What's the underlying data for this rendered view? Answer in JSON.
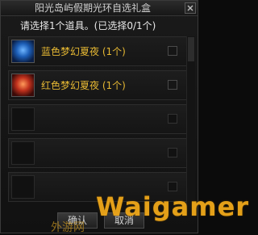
{
  "window": {
    "title": "阳光岛屿假期光环自选礼盒"
  },
  "instruction": "请选择1个道具。(已选择0/1个)",
  "items": [
    {
      "label": "蓝色梦幻夏夜 (1个)",
      "icon": "blue-summer-night-icon"
    },
    {
      "label": "红色梦幻夏夜 (1个)",
      "icon": "red-summer-night-icon"
    },
    {
      "label": "",
      "icon": "empty-slot"
    },
    {
      "label": "",
      "icon": "empty-slot"
    },
    {
      "label": "",
      "icon": "empty-slot"
    }
  ],
  "buttons": {
    "confirm_label": "确认",
    "cancel_label": "取消"
  },
  "watermark": {
    "text": "Waigamer",
    "sub": "外游网"
  },
  "colors": {
    "item_label": "#e6b833",
    "watermark": "#f0a81a"
  }
}
